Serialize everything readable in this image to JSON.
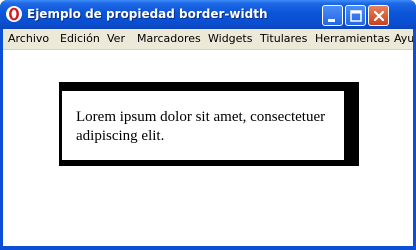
{
  "window": {
    "title": "Ejemplo de propiedad border-width",
    "app_icon": "opera-icon",
    "controls": [
      "minimize-icon",
      "maximize-icon",
      "close-icon"
    ]
  },
  "menu": {
    "items": [
      "Archivo",
      "Edición",
      "Ver",
      "Marcadores",
      "Widgets",
      "Titulares",
      "Herramientas",
      "Ayu"
    ]
  },
  "content": {
    "paragraph": "Lorem ipsum dolor sit amet, consectetuer adipiscing elit."
  },
  "colors": {
    "titlebar": "#0a55d8",
    "menubar": "#ece9d8",
    "border": "#000000",
    "close_button": "#c8421e"
  }
}
